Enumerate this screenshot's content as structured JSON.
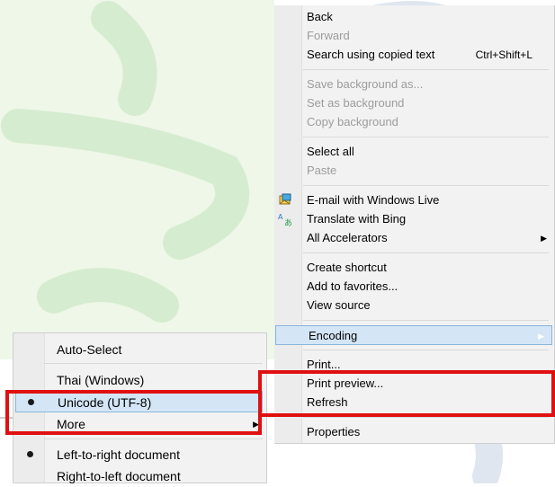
{
  "context_menu": {
    "items": [
      {
        "label": "Back",
        "enabled": true
      },
      {
        "label": "Forward",
        "enabled": false
      },
      {
        "label": "Search using copied text",
        "accelerator": "Ctrl+Shift+L",
        "enabled": true
      },
      {
        "label": "Save background as...",
        "enabled": false
      },
      {
        "label": "Set as background",
        "enabled": false
      },
      {
        "label": "Copy background",
        "enabled": false
      },
      {
        "label": "Select all",
        "enabled": true
      },
      {
        "label": "Paste",
        "enabled": false
      },
      {
        "label": "E-mail with Windows Live",
        "icon": "windows-live-mail-icon",
        "enabled": true
      },
      {
        "label": "Translate with Bing",
        "icon": "bing-translator-icon",
        "enabled": true
      },
      {
        "label": "All Accelerators",
        "submenu": true,
        "enabled": true
      },
      {
        "label": "Create shortcut",
        "enabled": true
      },
      {
        "label": "Add to favorites...",
        "enabled": true
      },
      {
        "label": "View source",
        "enabled": true
      },
      {
        "label": "Encoding",
        "submenu": true,
        "highlighted": true,
        "enabled": true
      },
      {
        "label": "Print...",
        "enabled": true
      },
      {
        "label": "Print preview...",
        "enabled": true
      },
      {
        "label": "Refresh",
        "enabled": true
      },
      {
        "label": "Properties",
        "enabled": true
      }
    ]
  },
  "encoding_menu": {
    "items": [
      {
        "label": "Auto-Select"
      },
      {
        "label": "Thai (Windows)"
      },
      {
        "label": "Unicode (UTF-8)",
        "selected": true,
        "highlighted": true
      },
      {
        "label": "More",
        "submenu": true
      },
      {
        "label": "Left-to-right document",
        "selected": true
      },
      {
        "label": "Right-to-left document"
      }
    ]
  },
  "colors": {
    "highlight": "#d4e6f6",
    "highlight_border": "#8ab4dc",
    "annotation_box": "#e01010",
    "disabled_text": "#9c9c9c"
  }
}
